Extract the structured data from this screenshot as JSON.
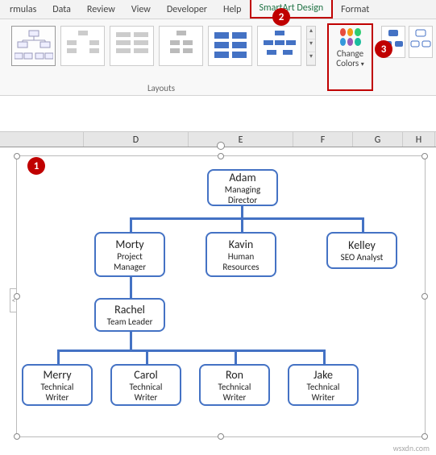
{
  "ribbon": {
    "tabs": [
      "rmulas",
      "Data",
      "Review",
      "View",
      "Developer",
      "Help",
      "SmartArt Design",
      "Format"
    ],
    "active_tab_index": 6,
    "layouts_label": "Layouts",
    "change_colors_label": "Change\nColors"
  },
  "badges": {
    "b1": "1",
    "b2": "2",
    "b3": "3"
  },
  "columns": [
    "D",
    "E",
    "F",
    "G",
    "H"
  ],
  "org": {
    "root": {
      "name": "Adam",
      "role": "Managing Director"
    },
    "level2": [
      {
        "name": "Morty",
        "role": "Project Manager"
      },
      {
        "name": "Kavin",
        "role": "Human Resources"
      },
      {
        "name": "Kelley",
        "role": "SEO Analyst"
      }
    ],
    "level3": {
      "name": "Rachel",
      "role": "Team Leader"
    },
    "level4": [
      {
        "name": "Merry",
        "role": "Technical Writer"
      },
      {
        "name": "Carol",
        "role": "Technical Writer"
      },
      {
        "name": "Ron",
        "role": "Technical Writer"
      },
      {
        "name": "Jake",
        "role": "Technical Writer"
      }
    ]
  },
  "colors": {
    "accent": "#4472c4",
    "badge": "#c00000",
    "excel_green": "#217346"
  },
  "watermark": "wsxdn.com"
}
